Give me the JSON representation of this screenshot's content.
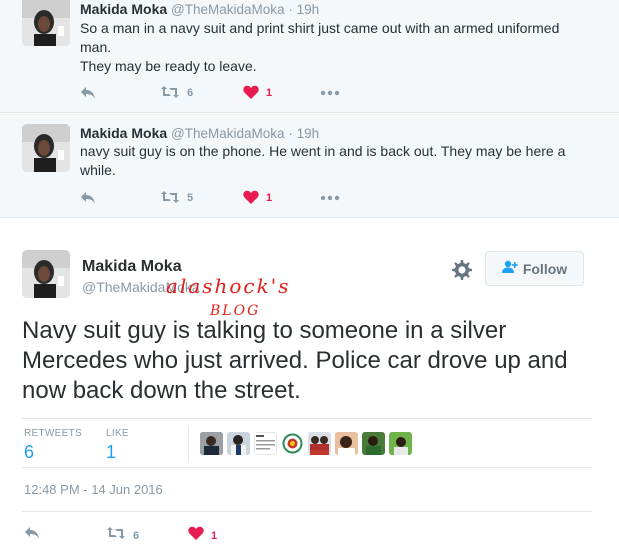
{
  "tweets": [
    {
      "name": "Makida Moka",
      "handle": "@TheMakidaMoka",
      "time": "· 19h",
      "text_line1": "So a man in a navy suit and print shirt just came out with an armed uniformed man.",
      "text_line2": "They may be ready to leave.",
      "retweets": "6",
      "likes": "1"
    },
    {
      "name": "Makida Moka",
      "handle": "@TheMakidaMoka",
      "time": "· 19h",
      "text_line1": "navy suit guy is on the phone. He went in and is back out. They may be here a while.",
      "retweets": "5",
      "likes": "1"
    }
  ],
  "main": {
    "name": "Makida Moka",
    "handle": "@TheMakidaMoka",
    "follow_label": "Follow",
    "text": "Navy suit guy is talking to someone in a silver Mercedes who just arrived. Police car drove up and now back down the street.",
    "retweets_label": "RETWEETS",
    "retweets_value": "6",
    "likes_label": "LIKE",
    "likes_value": "1",
    "timestamp": "12:48 PM - 14 Jun 2016",
    "action_retweets": "6",
    "action_likes": "1"
  },
  "watermark": {
    "line1": "alashock's",
    "line2": "BLOG"
  },
  "colors": {
    "accent": "#1da1f2",
    "heart": "#e81c4f",
    "muted": "#8899a6",
    "watermark": "#e0201b"
  },
  "icons": [
    "reply-icon",
    "retweet-icon",
    "heart-icon",
    "more-icon",
    "gear-icon",
    "follow-person-icon"
  ]
}
